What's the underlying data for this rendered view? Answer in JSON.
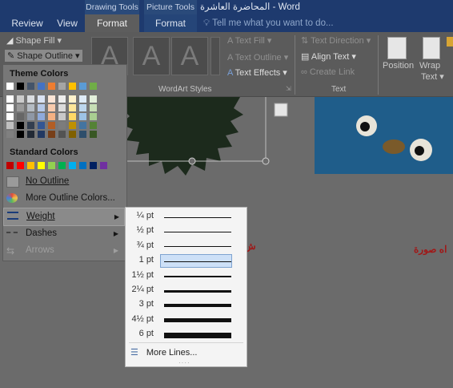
{
  "titlebar": {
    "drawing_tools": "Drawing Tools",
    "picture_tools": "Picture Tools",
    "window_title": "المحاضرة العاشرة - Word"
  },
  "tabs": [
    {
      "label": "Review"
    },
    {
      "label": "View"
    },
    {
      "label": "Format",
      "active": true
    },
    {
      "label": "Format"
    }
  ],
  "tell_me": "Tell me what you want to do...",
  "ribbon": {
    "shape_fill": "Shape Fill",
    "shape_outline": "Shape Outline",
    "wordart_letter": "A",
    "wordart_group": "WordArt Styles",
    "text_fill": "Text Fill",
    "text_outline": "Text Outline",
    "text_effects": "Text Effects",
    "text_direction": "Text Direction",
    "align_text": "Align Text",
    "create_link": "Create Link",
    "text_group": "Text",
    "position": "Position",
    "wrap_text_1": "Wrap",
    "wrap_text_2": "Text"
  },
  "menu": {
    "theme_colors_heading": "Theme Colors",
    "theme_top": [
      "#ffffff",
      "#000000",
      "#44546a",
      "#4472c4",
      "#ed7d31",
      "#a5a5a5",
      "#ffc000",
      "#5b9bd5",
      "#70ad47"
    ],
    "standard_colors_heading": "Standard Colors",
    "standard_colors": [
      "#c00000",
      "#ff0000",
      "#ffc000",
      "#ffff00",
      "#92d050",
      "#00b050",
      "#00b0f0",
      "#0070c0",
      "#002060",
      "#7030a0"
    ],
    "no_outline": "No Outline",
    "more_colors": "More Outline Colors...",
    "weight": "Weight",
    "dashes": "Dashes",
    "arrows": "Arrows"
  },
  "weights": [
    {
      "label": "¼ pt",
      "pt": 0.25
    },
    {
      "label": "½ pt",
      "pt": 0.5
    },
    {
      "label": "¾ pt",
      "pt": 0.75
    },
    {
      "label": "1 pt",
      "pt": 1,
      "selected": true
    },
    {
      "label": "1½ pt",
      "pt": 1.5
    },
    {
      "label": "2¼ pt",
      "pt": 2.25
    },
    {
      "label": "3 pt",
      "pt": 3
    },
    {
      "label": "4½ pt",
      "pt": 4.5
    },
    {
      "label": "6 pt",
      "pt": 6
    }
  ],
  "more_lines": "More Lines...",
  "document": {
    "arabic_right": "اه صورة",
    "arabic_left": "ش"
  }
}
